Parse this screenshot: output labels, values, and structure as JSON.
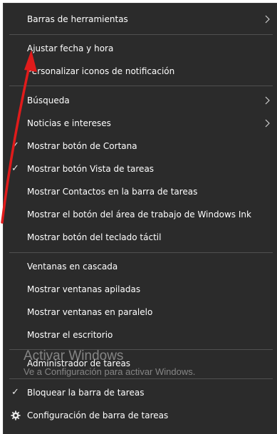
{
  "menu": {
    "toolbars": "Barras de herramientas",
    "adjust_datetime": "Ajustar fecha y hora",
    "customize_icons": "Personalizar iconos de notificación",
    "search": "Búsqueda",
    "news": "Noticias e intereses",
    "cortana": "Mostrar botón de Cortana",
    "task_view": "Mostrar botón Vista de tareas",
    "contacts": "Mostrar Contactos en la barra de tareas",
    "ink": "Mostrar el botón del área de trabajo de Windows Ink",
    "touch_keyboard": "Mostrar botón del teclado táctil",
    "cascade": "Ventanas en cascada",
    "stacked": "Mostrar ventanas apiladas",
    "side_by_side": "Mostrar ventanas en paralelo",
    "desktop": "Mostrar el escritorio",
    "task_manager": "Administrador de tareas",
    "lock_taskbar": "Bloquear la barra de tareas",
    "taskbar_settings": "Configuración de barra de tareas"
  },
  "checked": {
    "cortana": true,
    "task_view": true,
    "lock_taskbar": true
  },
  "watermark": {
    "title": "Activar Windows",
    "subtitle": "Ve a Configuración para activar Windows."
  },
  "icons": {
    "submenu": "chevron-right-icon",
    "check": "checkmark-icon",
    "settings": "gear-icon"
  },
  "colors": {
    "menu_bg": "#2b2b2b",
    "text": "#ffffff",
    "separator": "#505050",
    "annotation_arrow": "#e01b1b"
  }
}
